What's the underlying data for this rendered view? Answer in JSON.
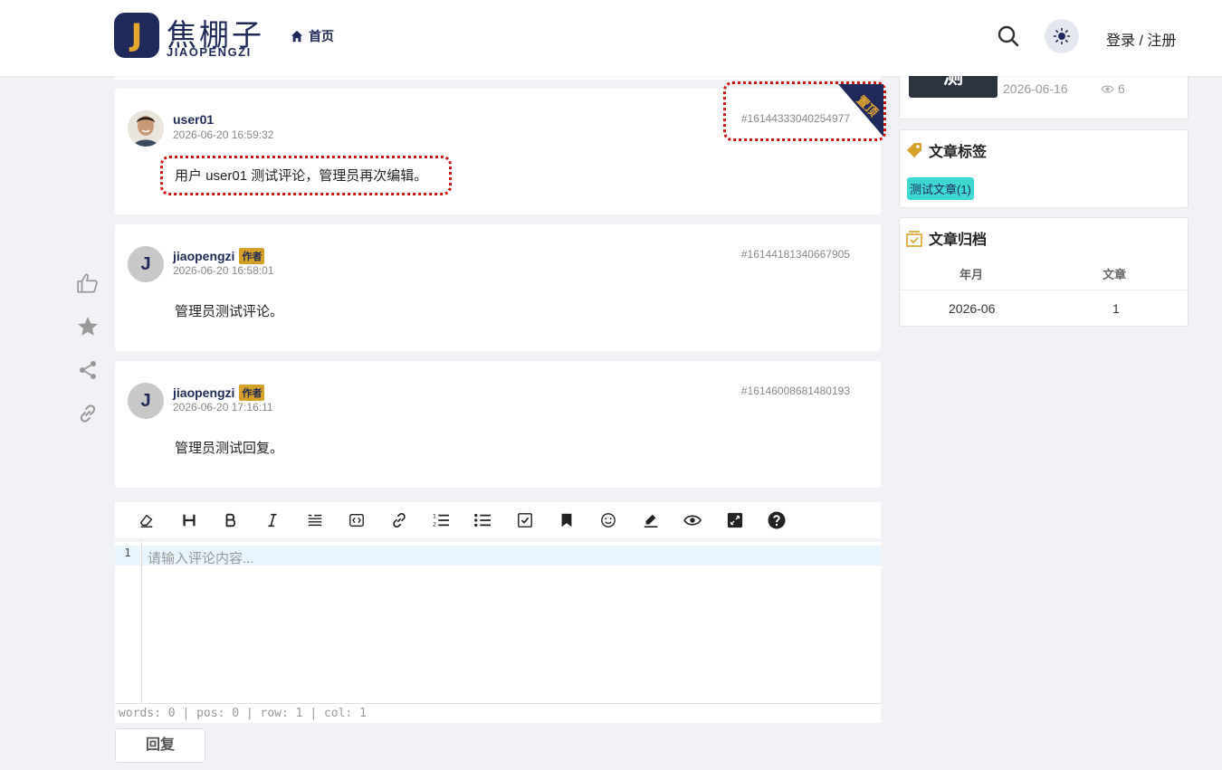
{
  "header": {
    "logo_letter": "J",
    "logo_cn": "焦棚子",
    "logo_en": "JIAOPENGZI",
    "nav_home": "首页",
    "login": "登录 / 注册"
  },
  "comments": [
    {
      "user": "user01",
      "time": "2026-06-20 16:59:32",
      "id": "#16144333040254977",
      "text": "用户 user01 测试评论，管理员再次编辑。",
      "pinned_label": "置顶"
    },
    {
      "user": "jiaopengzi",
      "avatar_letter": "J",
      "badge": "作者",
      "time": "2026-06-20 16:58:01",
      "id": "#16144181340667905",
      "text": "管理员测试评论。"
    },
    {
      "user": "jiaopengzi",
      "avatar_letter": "J",
      "badge": "作者",
      "time": "2026-06-20 17:16:11",
      "id": "#16146008681480193",
      "text": "管理员测试回复。"
    }
  ],
  "editor": {
    "line_number": "1",
    "placeholder": "请输入评论内容...",
    "status": "words: 0 | pos: 0 | row: 1 | col: 1",
    "reply_label": "回复",
    "toolbar_icons": [
      "eraser-icon",
      "heading-icon",
      "bold-icon",
      "italic-icon",
      "quote-icon",
      "code-icon",
      "link-icon",
      "ordered-list-icon",
      "unordered-list-icon",
      "checkbox-icon",
      "bookmark-icon",
      "emoji-icon",
      "highlight-icon",
      "preview-icon",
      "fullscreen-icon",
      "help-icon"
    ]
  },
  "sidebar": {
    "recent": {
      "thumb_text": "测",
      "date": "2026-06-16",
      "views": "6"
    },
    "tags": {
      "title": "文章标签",
      "items": [
        "测试文章(1)"
      ]
    },
    "archive": {
      "title": "文章归档",
      "headers": [
        "年月",
        "文章"
      ],
      "rows": [
        [
          "2026-06",
          "1"
        ]
      ]
    }
  },
  "colors": {
    "brand_navy": "#1f2a5a",
    "brand_gold": "#e3a72f",
    "tag_cyan": "#3fd8d0",
    "highlight_red": "#d01010"
  }
}
